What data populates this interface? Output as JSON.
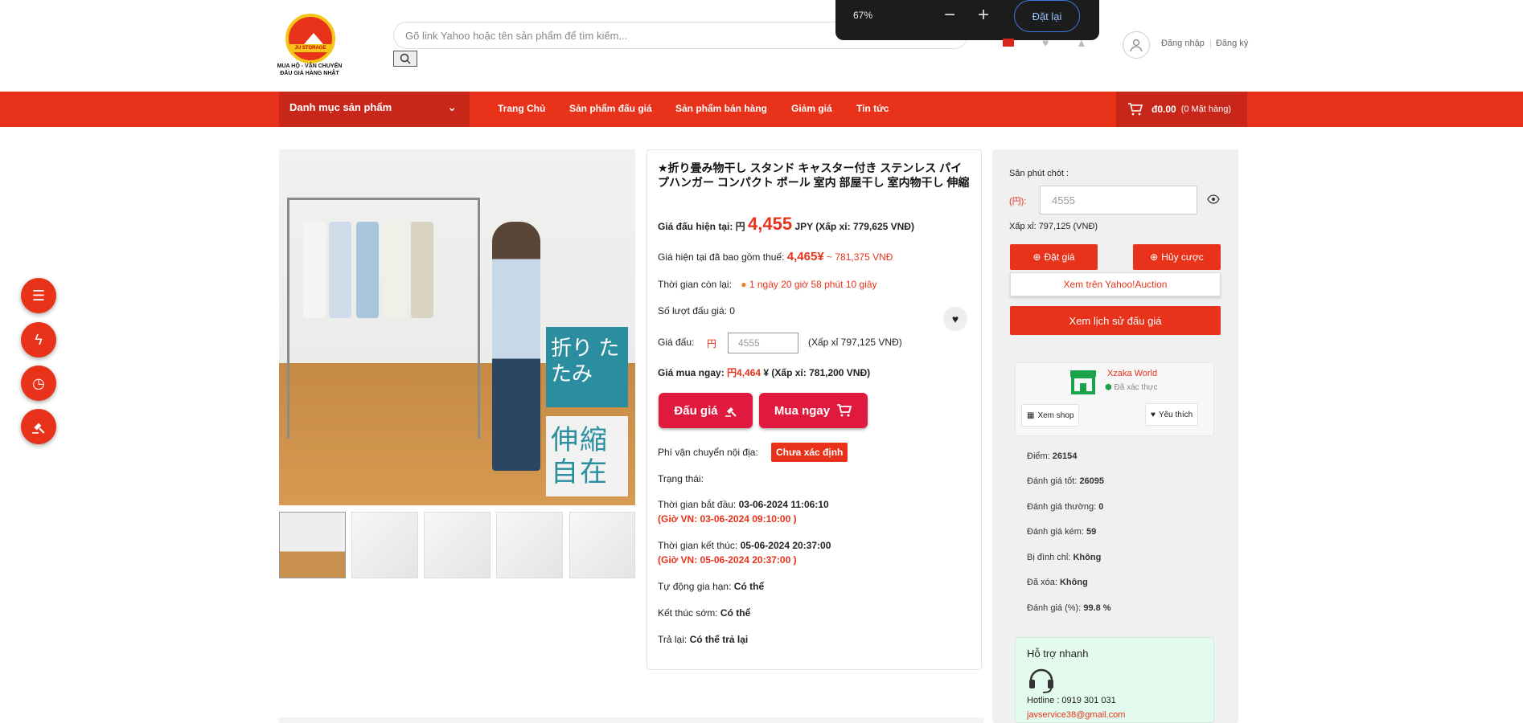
{
  "header": {
    "logo_band": "JU STORAGE",
    "logo_tagline_1": "MUA HỘ - VẬN CHUYỂN",
    "logo_tagline_2": "ĐẤU GIÁ HÀNG NHẬT",
    "search_placeholder": "Gõ link Yahoo hoặc tên sản phẩm để tìm kiếm...",
    "login": "Đăng nhập",
    "register": "Đăng ký"
  },
  "zoom": {
    "percent": "67%",
    "minus": "−",
    "plus": "+",
    "reset": "Đặt lại"
  },
  "nav": {
    "category": "Danh mục sản phẩm",
    "items": [
      "Trang Chủ",
      "Sản phẩm đấu giá",
      "Sản phẩm bán hàng",
      "Giảm giá",
      "Tin tức"
    ],
    "cart_amount": "đ0.00",
    "cart_count": "(0 Mặt hàng)"
  },
  "image_tags": {
    "tag1": "折り たたみ",
    "tag2": "伸縮 自在"
  },
  "product": {
    "title": "★折り畳み物干し スタンド キャスター付き ステンレス パイプハンガー コンパクト ポール 室内 部屋干し 室内物干し 伸縮",
    "current_bid_label": "Giá đấu hiện tại: 円",
    "current_bid_value": "4,455",
    "current_bid_suffix": "JPY (Xấp xỉ: 779,625 VNĐ)",
    "tax_label": "Giá hiện tại đã bao gồm thuế:",
    "tax_value": "4,465¥",
    "tax_vnd": "~ 781,375 VNĐ",
    "remaining_label": "Thời gian còn lại:",
    "remaining_value": "1 ngày 20 giờ 58 phút 10 giây",
    "bid_count": "Số lượt đấu giá: 0",
    "bid_label": "Giá đấu:",
    "bid_currency": "円",
    "bid_input": "4555",
    "bid_approx": "(Xấp xỉ 797,125 VNĐ)",
    "buy_label": "Giá mua ngay:",
    "buy_value": "円4,464",
    "buy_suffix": "¥ (Xấp xỉ: 781,200 VNĐ)",
    "bid_button": "Đấu giá",
    "buy_button": "Mua ngay",
    "shipping_label": "Phí vận chuyển nội địa:",
    "shipping_value": "Chưa xác định",
    "status_label": "Trạng thái:",
    "start_label": "Thời gian bắt đầu:",
    "start_value": "03-06-2024 11:06:10",
    "start_vn": "(Giờ VN: 03-06-2024 09:10:00 )",
    "end_label": "Thời gian kết thúc:",
    "end_value": "05-06-2024 20:37:00",
    "end_vn": "(Giờ VN: 05-06-2024 20:37:00 )",
    "auto_ext_label": "Tự động gia hạn:",
    "auto_ext_value": "Có thể",
    "early_end_label": "Kết thúc sớm:",
    "early_end_value": "Có thể",
    "return_label": "Trả lại:",
    "return_value": "Có thể trả lại"
  },
  "snipe": {
    "label": "Săn phút chót :",
    "currency": "(円):",
    "input": "4555",
    "approx": "Xấp xỉ: 797,125 (VNĐ)",
    "place_bid": "Đặt giá",
    "cancel_bid": "Hủy cược",
    "yahoo_link": "Xem trên Yahoo!Auction",
    "history": "Xem lịch sử đấu giá"
  },
  "seller": {
    "name": "Xzaka World",
    "verified": "Đã xác thực",
    "view_shop": "Xem shop",
    "favorite": "Yêu thích",
    "stats": [
      {
        "label": "Điểm:",
        "value": "26154"
      },
      {
        "label": "Đánh giá tốt:",
        "value": "26095"
      },
      {
        "label": "Đánh giá thường:",
        "value": "0"
      },
      {
        "label": "Đánh giá kém:",
        "value": "59"
      },
      {
        "label": "Bị đình chỉ:",
        "value": "Không"
      },
      {
        "label": "Đã xóa:",
        "value": "Không"
      },
      {
        "label": "Đánh giá (%):",
        "value": "99.8 %"
      }
    ]
  },
  "support": {
    "title": "Hỗ trợ nhanh",
    "hotline": "Hotline : 0919 301 031",
    "email": "javservice38@gmail.com"
  },
  "colors": {
    "accent": "#e8321a",
    "button": "#e0193e"
  }
}
